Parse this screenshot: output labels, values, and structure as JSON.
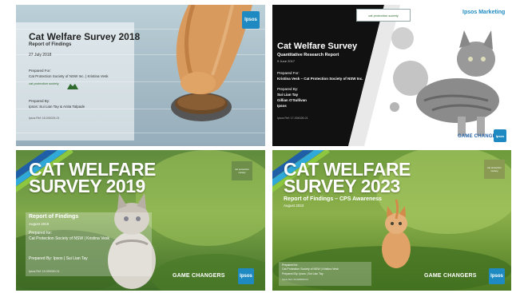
{
  "slides": [
    {
      "title": "Cat Welfare Survey 2018",
      "subtitle": "Report of Findings",
      "date": "27 July 2018",
      "prepared_for_label": "Prepared For:",
      "prepared_for": "Cat Protection Society of NSW Inc. | Kristina Vesk",
      "cps_logo_text": "cat protection society",
      "prepared_by_label": "Prepared By:",
      "prepared_by": "Ipsos: Sui Lian Tay & Anita Talpade",
      "ref": "Ipsos Ref: 18-040024-01",
      "brand": "Ipsos"
    },
    {
      "title": "Cat Welfare Survey",
      "subtitle": "Quantitative Research Report",
      "date": "9 June 2017",
      "prepared_for_label": "Prepared For:",
      "prepared_for": "Kristina Vesk – Cat Protection Society of NSW Inc.",
      "prepared_by_label": "Prepared By:",
      "prepared_by_1": "Sui Lian Tay",
      "prepared_by_2": "Gillian O'Sullivan",
      "prepared_by_3": "Ipsos",
      "ref": "Ipsos Ref: 17-004026-01",
      "cps_logo_text": "cat protection society",
      "marketing": "Ipsos Marketing",
      "game_changers": "GAME CHANGERS",
      "brand": "Ipsos"
    },
    {
      "title_line1": "CAT WELFARE",
      "title_line2": "SURVEY 2019",
      "subtitle": "Report of Findings",
      "date": "August 2019",
      "prepared_for_label": "Prepared for:",
      "prepared_for": "Cat Protection Society of NSW | Kristina Vesk",
      "prepared_by": "Prepared By: Ipsos | Sui Lian Tay",
      "ref": "Ipsos Ref: 19-000000-01",
      "cps_logo_text": "cat protection society",
      "game_changers": "GAME CHANGERS",
      "brand": "Ipsos"
    },
    {
      "title_line1": "CAT WELFARE",
      "title_line2": "SURVEY 2023",
      "subtitle": "Report of Findings – CPS Awareness",
      "date": "August 2023",
      "prepared_for_label": "Prepared for:",
      "prepared_for": "Cat Protection Society of NSW | Kristina Vesk",
      "prepared_by": "Prepared By: Ipsos | Sui Lian Tay",
      "ref": "Ipsos Ref: 23-000000-01",
      "cps_logo_text": "cat protection society",
      "game_changers": "GAME CHANGERS",
      "brand": "Ipsos"
    }
  ]
}
